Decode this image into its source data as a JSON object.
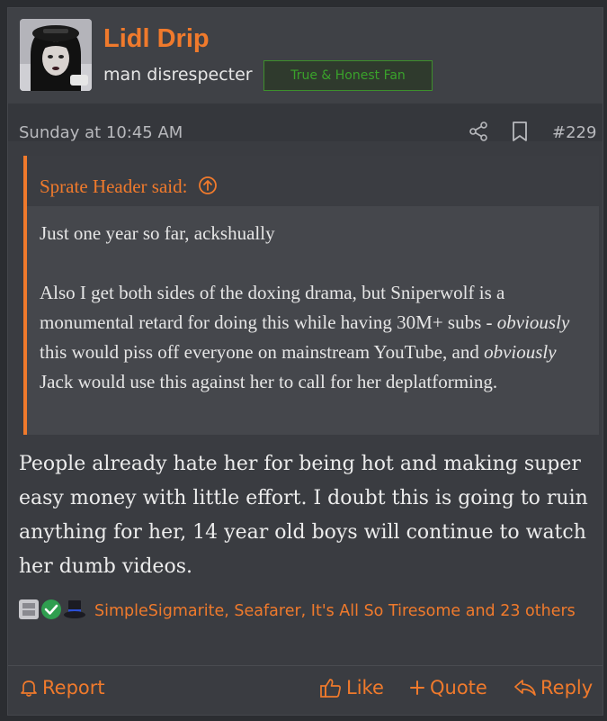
{
  "user": {
    "name": "Lidl Drip",
    "title": "man disrespecter",
    "banner": "True & Honest Fan"
  },
  "meta": {
    "date": "Sunday at 10:45 AM",
    "post_number": "#229",
    "share_icon": "share-icon",
    "bookmark_icon": "bookmark-icon"
  },
  "quote": {
    "author": "Sprate Header said:",
    "line1": "Just one year so far, ackshually",
    "p2_a": "Also I get both sides of the doxing drama, but Sniperwolf is a monumental retard for doing this while having 30M+ subs - ",
    "p2_em1": "obviously",
    "p2_b": " this would piss off everyone on mainstream YouTube, and ",
    "p2_em2": "obviously",
    "p2_c": " Jack would use this against her to call for her deplatforming."
  },
  "body": "People already hate her for being hot and making super easy money with little effort. I doubt this is going to ruin anything for her, 14 year old boys will continue to watch her dumb videos.",
  "reactions": {
    "text": "SimpleSigmarite, Seafarer, It's All So Tiresome and 23 others"
  },
  "footer": {
    "report": "Report",
    "like": "Like",
    "quote": "Quote",
    "reply": "Reply"
  },
  "colors": {
    "accent": "#f07a2c",
    "banner_green": "#3aa22b",
    "background": "#3a3c41"
  }
}
